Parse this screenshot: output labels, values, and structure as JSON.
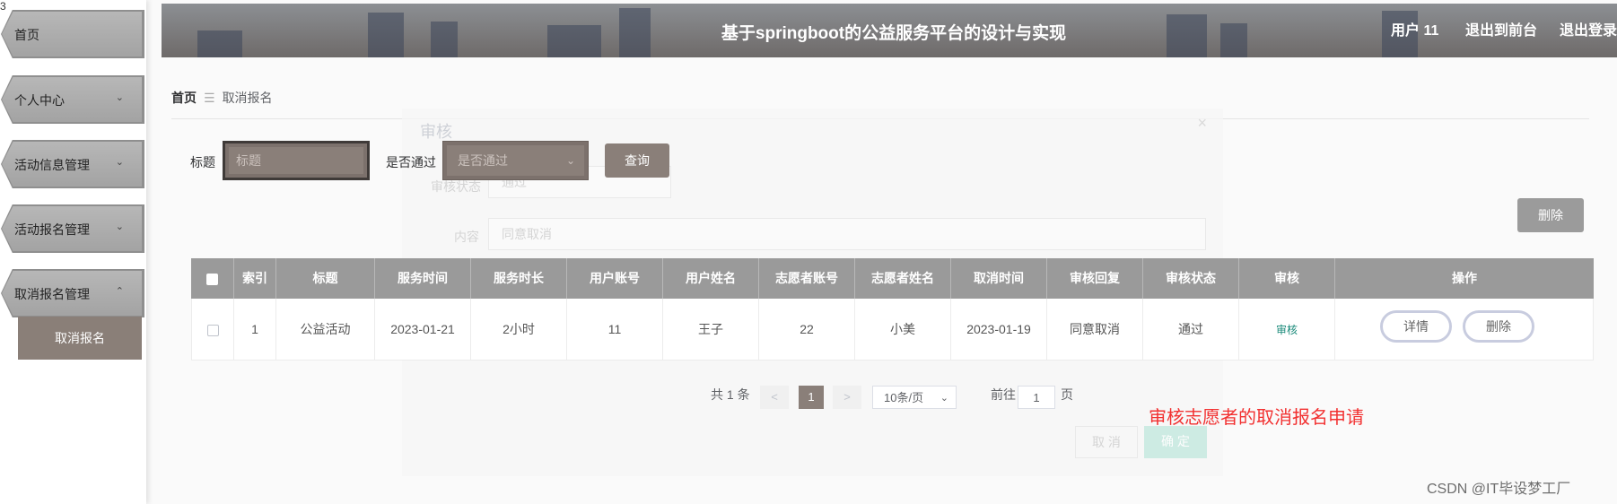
{
  "sidebar": {
    "corner_glyph": "3",
    "items": [
      {
        "label": "首页",
        "chevron": ""
      },
      {
        "label": "个人中心",
        "chevron": "⌄"
      },
      {
        "label": "活动信息管理",
        "chevron": "⌄"
      },
      {
        "label": "活动报名管理",
        "chevron": "⌄"
      },
      {
        "label": "取消报名管理",
        "chevron": "⌃"
      }
    ],
    "submenu": {
      "label": "取消报名"
    }
  },
  "header": {
    "title": "基于springboot的公益服务平台的设计与实现",
    "user_label": "用户 11",
    "back_label": "退出到前台",
    "logout_label": "退出登录"
  },
  "breadcrumb": {
    "home": "首页",
    "separator": "☰",
    "current": "取消报名"
  },
  "dialog": {
    "title": "审核",
    "close": "×",
    "status_label": "审核状态",
    "status_value": "通过",
    "content_label": "内容",
    "content_value": "同意取消",
    "cancel_label": "取 消",
    "confirm_label": "确 定"
  },
  "search": {
    "title_label": "标题",
    "title_placeholder": "标题",
    "pass_label": "是否通过",
    "pass_placeholder": "是否通过",
    "query_label": "查询"
  },
  "toolbar": {
    "delete_label": "删除"
  },
  "table": {
    "columns": [
      "",
      "索引",
      "标题",
      "服务时间",
      "服务时长",
      "用户账号",
      "用户姓名",
      "志愿者账号",
      "志愿者姓名",
      "取消时间",
      "审核回复",
      "审核状态",
      "审核",
      "操作"
    ],
    "rows": [
      {
        "index": "1",
        "title": "公益活动",
        "service_time": "2023-01-21",
        "service_duration": "2小时",
        "user_account": "11",
        "user_name": "王子",
        "volunteer_account": "22",
        "volunteer_name": "小美",
        "cancel_time": "2023-01-19",
        "audit_reply": "同意取消",
        "audit_status": "通过",
        "audit_action": "审核",
        "detail_label": "详情",
        "delete_label": "删除"
      }
    ]
  },
  "pagination": {
    "total": "共 1 条",
    "prev": "<",
    "current_page": "1",
    "next": ">",
    "page_size": "10条/页",
    "goto_prefix": "前往",
    "goto_value": "1",
    "goto_suffix": "页"
  },
  "annotation": "审核志愿者的取消报名申请",
  "watermark": "CSDN @IT毕设梦工厂",
  "colors": {
    "accent": "#8a7f79",
    "table_header": "#9a9a9a",
    "highlight": "#f23030"
  }
}
